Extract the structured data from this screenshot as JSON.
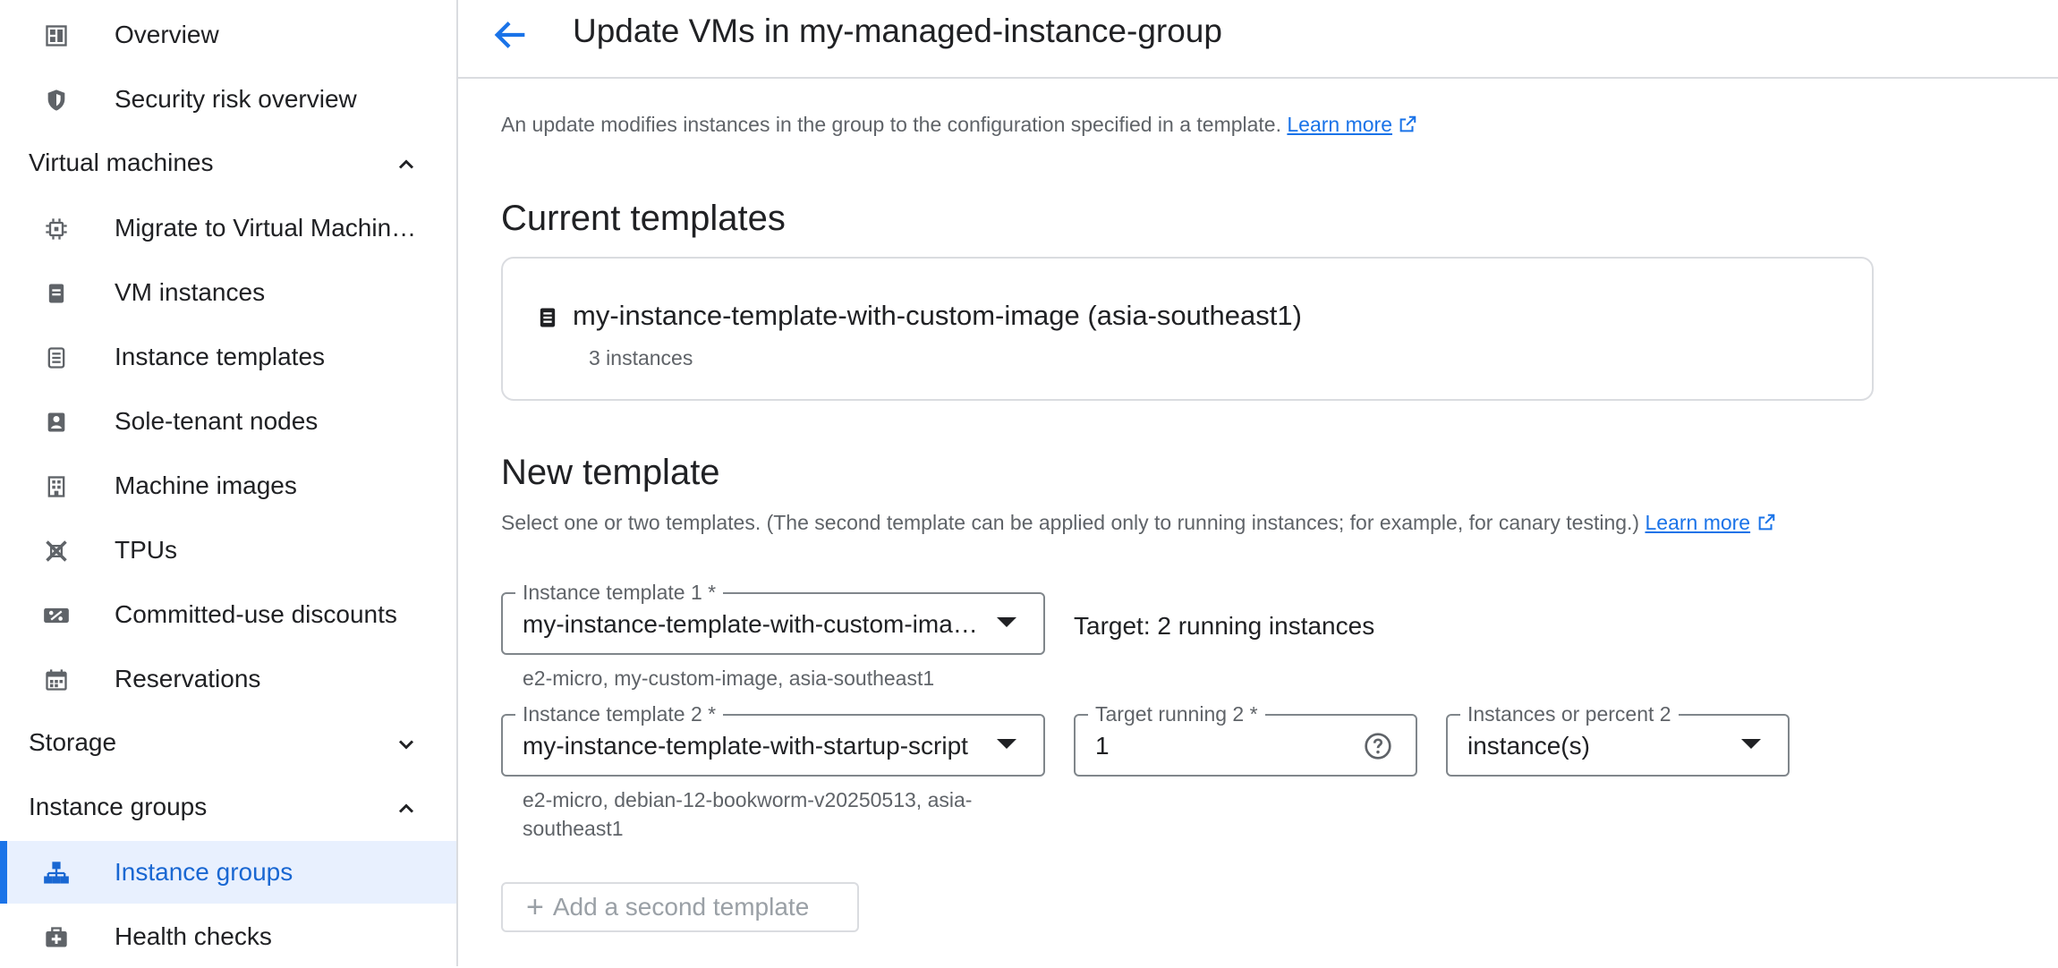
{
  "sidebar": {
    "items_top": [
      {
        "label": "Overview",
        "icon": "dashboard-icon"
      },
      {
        "label": "Security risk overview",
        "icon": "shield-icon"
      }
    ],
    "sections": [
      {
        "title": "Virtual machines",
        "expanded": true
      },
      {
        "title": "Storage",
        "expanded": false
      },
      {
        "title": "Instance groups",
        "expanded": true
      }
    ],
    "vm_items": [
      {
        "label": "Migrate to Virtual Machin…",
        "icon": "migrate-chip-icon"
      },
      {
        "label": "VM instances",
        "icon": "vm-instance-icon"
      },
      {
        "label": "Instance templates",
        "icon": "template-icon"
      },
      {
        "label": "Sole-tenant nodes",
        "icon": "sole-tenant-icon"
      },
      {
        "label": "Machine images",
        "icon": "machine-image-icon"
      },
      {
        "label": "TPUs",
        "icon": "tpu-icon"
      },
      {
        "label": "Committed-use discounts",
        "icon": "percent-icon"
      },
      {
        "label": "Reservations",
        "icon": "calendar-icon"
      }
    ],
    "ig_items": [
      {
        "label": "Instance groups",
        "icon": "instance-groups-icon",
        "active": true
      },
      {
        "label": "Health checks",
        "icon": "health-check-icon"
      }
    ]
  },
  "header": {
    "title": "Update VMs in my-managed-instance-group"
  },
  "intro": {
    "text": "An update modifies instances in the group to the configuration specified in a template.",
    "link": "Learn more"
  },
  "current_templates": {
    "heading": "Current templates",
    "name": "my-instance-template-with-custom-image (asia-southeast1)",
    "count": "3 instances"
  },
  "new_template": {
    "heading": "New template",
    "description": "Select one or two templates. (The second template can be applied only to running instances; for example, for canary testing.)",
    "link": "Learn more",
    "template1": {
      "label": "Instance template 1 *",
      "value": "my-instance-template-with-custom-image",
      "hint": "e2-micro, my-custom-image, asia-southeast1",
      "target": "Target: 2 running instances"
    },
    "template2": {
      "label": "Instance template 2 *",
      "value": "my-instance-template-with-startup-script",
      "hint_line1": "e2-micro, debian-12-bookworm-v20250513, asia-",
      "hint_line2": "southeast1"
    },
    "target_running": {
      "label": "Target running 2 *",
      "value": "1"
    },
    "instances_or_percent": {
      "label": "Instances or percent 2",
      "value": "instance(s)"
    },
    "add_button": "Add a second template"
  },
  "colors": {
    "accent": "#1a73e8",
    "active_bg": "#e8f0fe",
    "border": "#dadce0"
  }
}
